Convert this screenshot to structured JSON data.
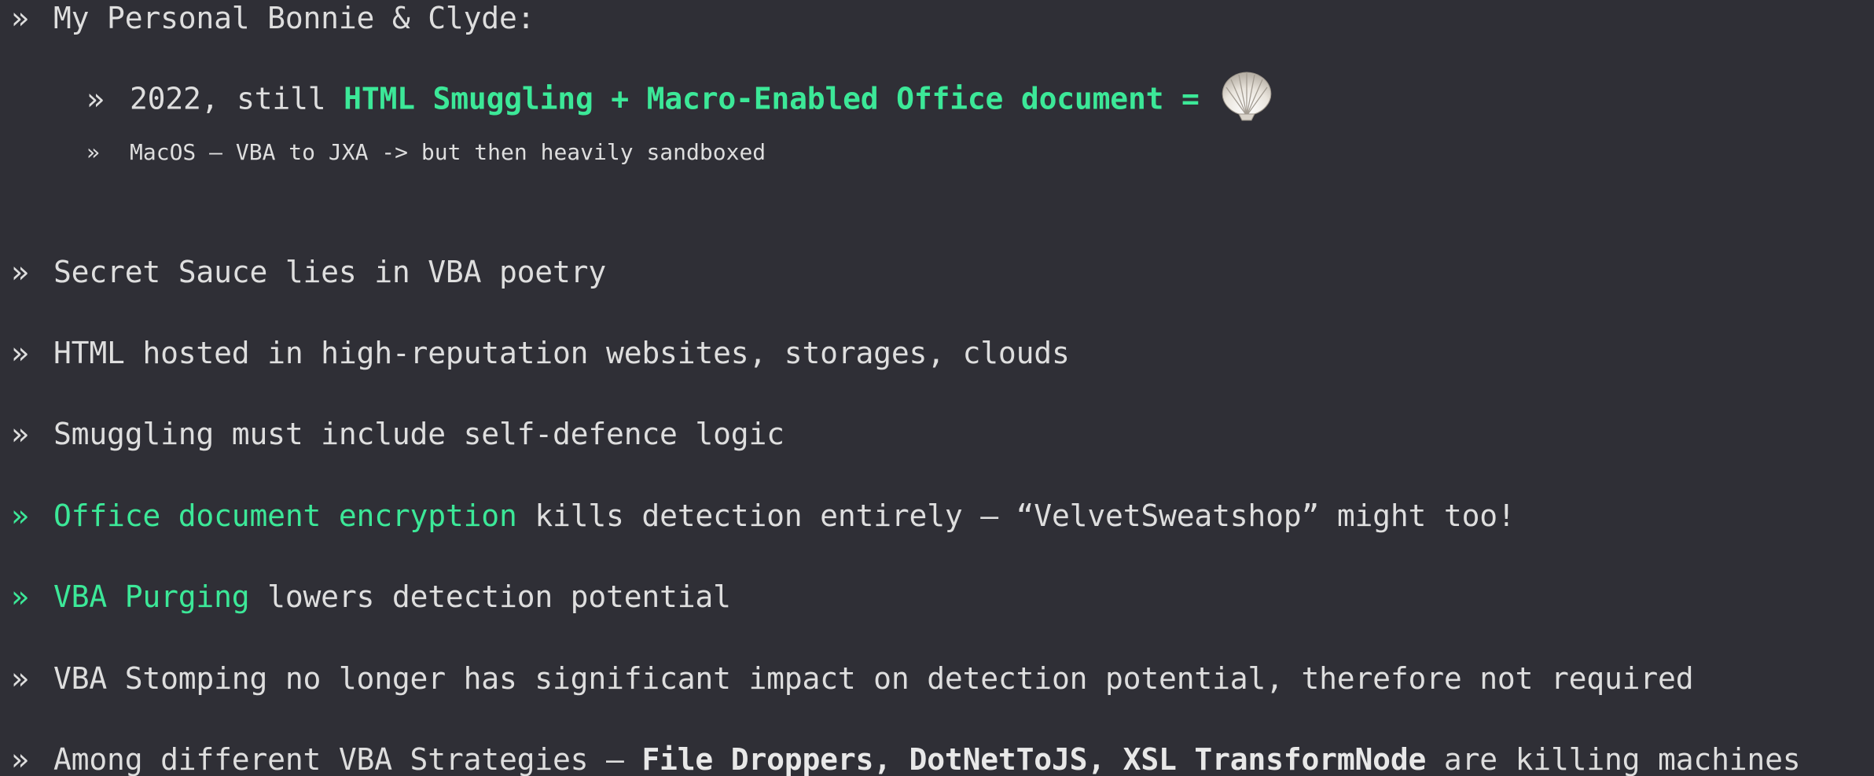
{
  "bullet_glyph": "»",
  "items": [
    {
      "text": "My Personal Bonnie & Clyde:"
    },
    {
      "prefix": "2022, still ",
      "highlight": "HTML Smuggling + Macro-Enabled Office document =",
      "icon": "shell-icon"
    },
    {
      "text": "MacOS – VBA to JXA -> but then heavily sandboxed"
    },
    {
      "text": "Secret Sauce lies in VBA poetry"
    },
    {
      "text": "HTML hosted in high-reputation websites, storages, clouds"
    },
    {
      "text": "Smuggling must include self-defence logic"
    },
    {
      "highlight": "Office document encryption",
      "suffix": " kills detection entirely – “VelvetSweatshop” might too!"
    },
    {
      "highlight": "VBA Purging",
      "suffix": " lowers detection potential"
    },
    {
      "text": "VBA Stomping no longer has significant impact on detection potential, therefore not required"
    },
    {
      "prefix": "Among different VBA Strategies – ",
      "bold": "File Droppers, DotNetToJS, XSL TransformNode",
      "suffix": " are killing machines"
    }
  ],
  "colors": {
    "background": "#2f2f36",
    "text": "#dedede",
    "accent": "#3ce898"
  }
}
